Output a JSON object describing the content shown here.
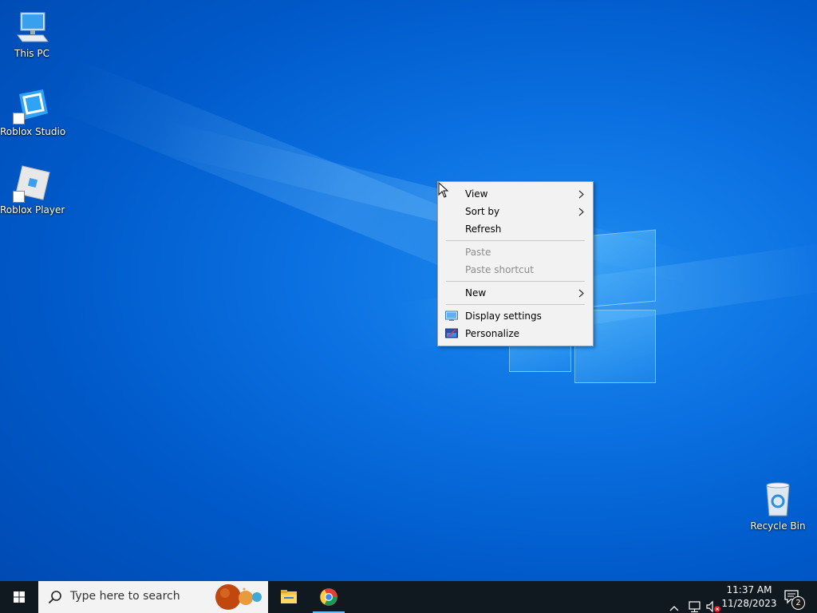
{
  "desktop": {
    "icons": [
      {
        "label": "This PC",
        "icon": "computer-icon"
      },
      {
        "label": "Roblox Studio",
        "icon": "roblox-studio-icon"
      },
      {
        "label": "Roblox Player",
        "icon": "roblox-player-icon"
      },
      {
        "label": "Recycle Bin",
        "icon": "recycle-bin-icon"
      }
    ]
  },
  "context_menu": {
    "items": [
      {
        "label": "View",
        "submenu": true,
        "disabled": false
      },
      {
        "label": "Sort by",
        "submenu": true,
        "disabled": false
      },
      {
        "label": "Refresh",
        "submenu": false,
        "disabled": false
      },
      {
        "label": "Paste",
        "submenu": false,
        "disabled": true
      },
      {
        "label": "Paste shortcut",
        "submenu": false,
        "disabled": true
      },
      {
        "label": "New",
        "submenu": true,
        "disabled": false
      },
      {
        "label": "Display settings",
        "icon": "display-settings-icon"
      },
      {
        "label": "Personalize",
        "icon": "personalize-icon"
      }
    ]
  },
  "taskbar": {
    "search_placeholder": "Type here to search",
    "pinned": [
      {
        "name": "file-explorer",
        "icon": "folder-icon",
        "active": false
      },
      {
        "name": "chrome",
        "icon": "chrome-icon",
        "active": true
      }
    ],
    "tray": {
      "time": "11:37 AM",
      "date": "11/28/2023",
      "notification_count": "2"
    }
  },
  "colors": {
    "desktop_blue": "#0a6fe0",
    "taskbar": "#101820",
    "menu_bg": "#f2f2f2",
    "accent": "#76b9ed"
  }
}
